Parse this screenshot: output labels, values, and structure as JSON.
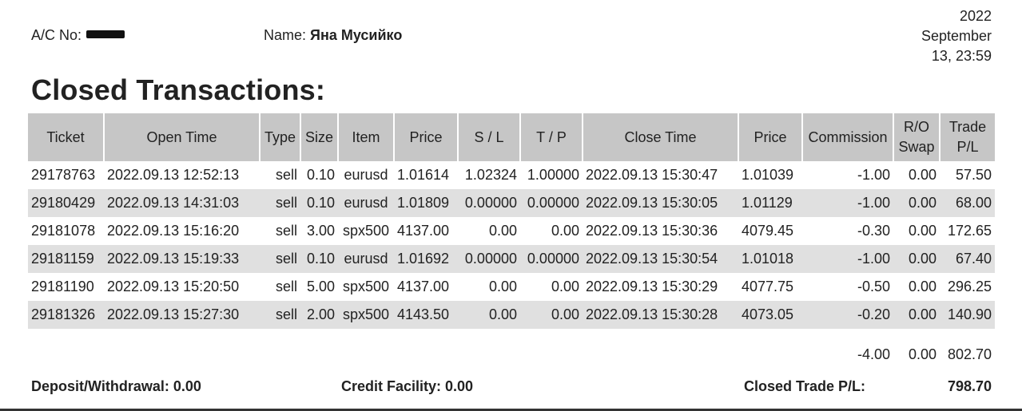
{
  "header": {
    "account_label": "A/C No:",
    "name_label": "Name:",
    "name_value": "Яна Мусийко",
    "date_line1": "2022",
    "date_line2": "September",
    "date_line3": "13, 23:59"
  },
  "title": "Closed Transactions:",
  "table": {
    "columns": [
      "Ticket",
      "Open Time",
      "Type",
      "Size",
      "Item",
      "Price",
      "S / L",
      "T / P",
      "Close Time",
      "Price",
      "Commission",
      "R/O Swap",
      "Trade P/L"
    ],
    "column_lines": [
      [
        "Ticket"
      ],
      [
        "Open Time"
      ],
      [
        "Type"
      ],
      [
        "Size"
      ],
      [
        "Item"
      ],
      [
        "Price"
      ],
      [
        "S / L"
      ],
      [
        "T / P"
      ],
      [
        "Close Time"
      ],
      [
        "Price"
      ],
      [
        "Commission"
      ],
      [
        "R/O",
        "Swap"
      ],
      [
        "Trade",
        "P/L"
      ]
    ],
    "rows": [
      [
        "29178763",
        "2022.09.13 12:52:13",
        "sell",
        "0.10",
        "eurusd",
        "1.01614",
        "1.02324",
        "1.00000",
        "2022.09.13 15:30:47",
        "1.01039",
        "-1.00",
        "0.00",
        "57.50"
      ],
      [
        "29180429",
        "2022.09.13 14:31:03",
        "sell",
        "0.10",
        "eurusd",
        "1.01809",
        "0.00000",
        "0.00000",
        "2022.09.13 15:30:05",
        "1.01129",
        "-1.00",
        "0.00",
        "68.00"
      ],
      [
        "29181078",
        "2022.09.13 15:16:20",
        "sell",
        "3.00",
        "spx500",
        "4137.00",
        "0.00",
        "0.00",
        "2022.09.13 15:30:36",
        "4079.45",
        "-0.30",
        "0.00",
        "172.65"
      ],
      [
        "29181159",
        "2022.09.13 15:19:33",
        "sell",
        "0.10",
        "eurusd",
        "1.01692",
        "0.00000",
        "0.00000",
        "2022.09.13 15:30:54",
        "1.01018",
        "-1.00",
        "0.00",
        "67.40"
      ],
      [
        "29181190",
        "2022.09.13 15:20:50",
        "sell",
        "5.00",
        "spx500",
        "4137.00",
        "0.00",
        "0.00",
        "2022.09.13 15:30:29",
        "4077.75",
        "-0.50",
        "0.00",
        "296.25"
      ],
      [
        "29181326",
        "2022.09.13 15:27:30",
        "sell",
        "2.00",
        "spx500",
        "4143.50",
        "0.00",
        "0.00",
        "2022.09.13 15:30:28",
        "4073.05",
        "-0.20",
        "0.00",
        "140.90"
      ]
    ],
    "totals": {
      "commission": "-4.00",
      "swap": "0.00",
      "trade_pl": "802.70"
    }
  },
  "footer": {
    "deposit_withdrawal": "Deposit/Withdrawal: 0.00",
    "credit_facility": "Credit Facility: 0.00",
    "closed_trade_pl_label": "Closed Trade P/L:",
    "closed_trade_pl_value": "798.70"
  },
  "colors": {
    "header_bg": "#c6c6c6",
    "row_shade": "#e0e0e0"
  }
}
